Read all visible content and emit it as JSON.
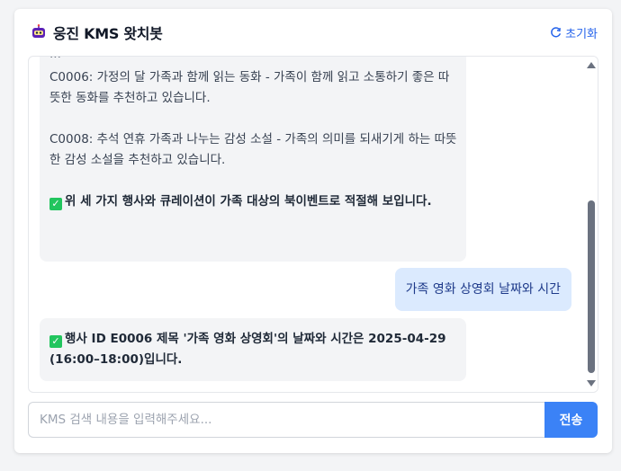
{
  "header": {
    "title": "웅진 KMS 왓치봇",
    "reset_label": "초기화"
  },
  "messages": {
    "bot1": {
      "cut_line": "...",
      "p1": "C0006: 가정의 달 가족과 함께 읽는 동화 - 가족이 함께 읽고 소통하기 좋은 따뜻한 동화를 추천하고 있습니다.",
      "p2": "C0008: 추석 연휴 가족과 나누는 감성 소설 - 가족의 의미를 되새기게 하는 따뜻한 감성 소설을 추천하고 있습니다.",
      "p3": "위 세 가지 행사와 큐레이션이 가족 대상의 북이벤트로 적절해 보입니다."
    },
    "user1": "가족 영화 상영회 날짜와 시간",
    "bot2": "행사 ID E0006 제목 '가족 영화 상영회'의 날짜와 시간은 2025-04-29 (16:00–18:00)입니다."
  },
  "input": {
    "placeholder": "KMS 검색 내용을 입력해주세요...",
    "value": ""
  },
  "send_label": "전송",
  "colors": {
    "accent": "#3b82f6",
    "user_bubble": "#dbeafe",
    "bot_bubble": "#f3f4f6",
    "check": "#22c55e"
  }
}
